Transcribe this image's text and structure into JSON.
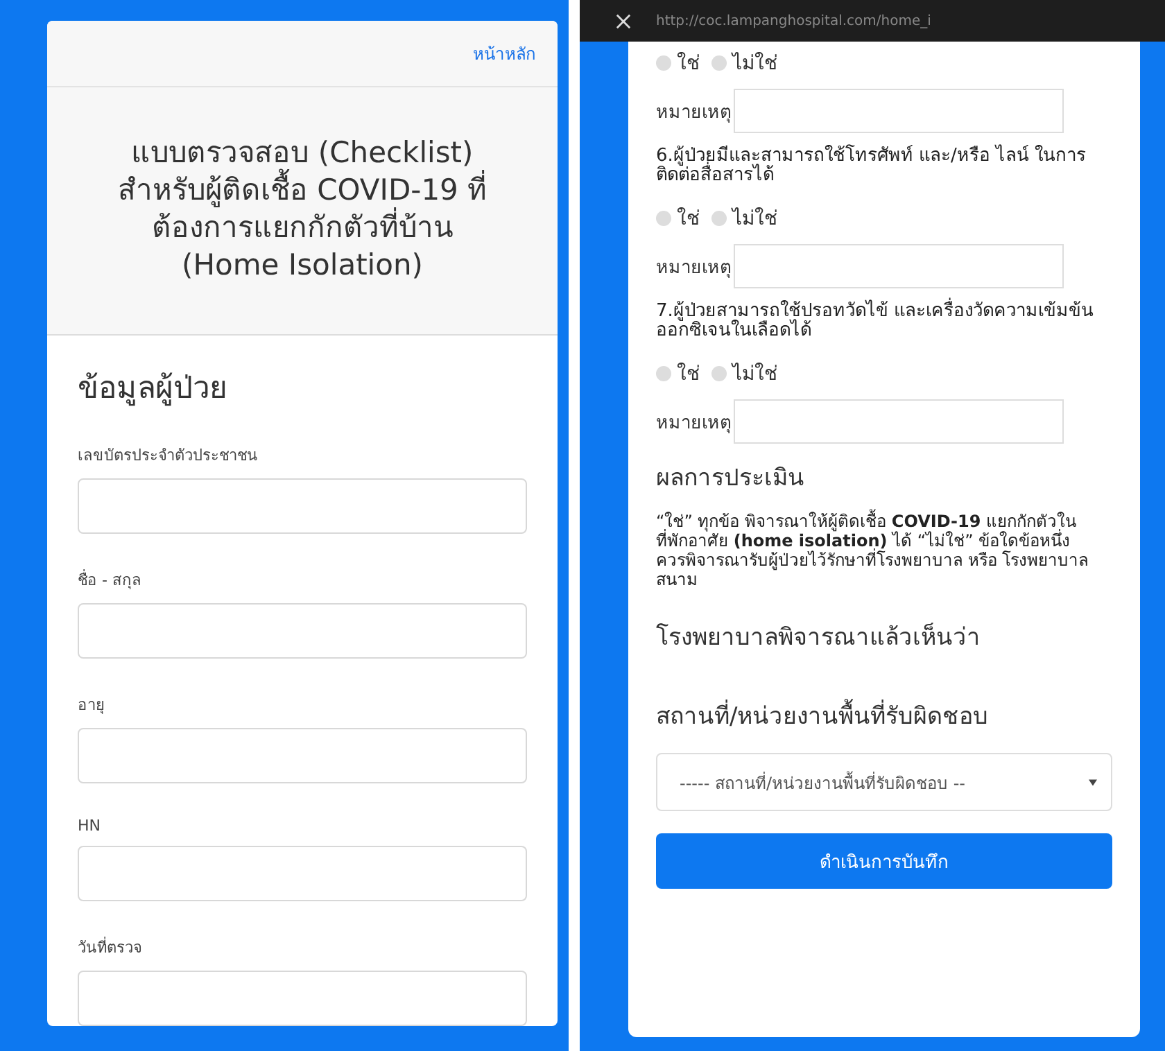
{
  "left_screen": {
    "header_link": "หน้าหลัก",
    "title": "แบบตรวจสอบ (Checklist) สำหรับผู้ติดเชื้อ COVID-19 ที่ต้องการแยกกักตัวที่บ้าน (Home Isolation)",
    "section_title": "ข้อมูลผู้ป่วย",
    "fields": [
      {
        "label": "เลขบัตรประจำตัวประชาชน"
      },
      {
        "label": "ชื่อ - สกุล"
      },
      {
        "label": "อายุ"
      },
      {
        "label": "HN"
      },
      {
        "label": "วันที่ตรวจ"
      }
    ]
  },
  "right_screen": {
    "browser_bar": {
      "url": "http://coc.lampanghospital.com/home_i"
    },
    "questions": [
      {
        "options": [
          {
            "label": "ใช่",
            "selected": false
          },
          {
            "label": "ไม่ใช่",
            "selected": false
          }
        ],
        "note_label": "หมายเหตุ"
      },
      {
        "text": "6.ผู้ป่วยมีและสามารถใช้โทรศัพท์ และ/หรือ ไลน์ ในการติดต่อสื่อสารได้",
        "options": [
          {
            "label": "ใช่",
            "selected": false
          },
          {
            "label": "ไม่ใช่",
            "selected": false
          }
        ],
        "note_label": "หมายเหตุ"
      },
      {
        "text": "7.ผู้ป่วยสามารถใช้ปรอทวัดไข้ และเครื่องวัดความเข้มข้นออกซิเจนในเลือดได้",
        "options": [
          {
            "label": "ใช่",
            "selected": false
          },
          {
            "label": "ไม่ใช่",
            "selected": false
          }
        ],
        "note_label": "หมายเหตุ"
      }
    ],
    "result_title": "ผลการประเมิน",
    "result_text": "“ใช่” ทุกข้อ พิจารณาให้ผู้ติดเชื้อ **COVID-19** แยกกักตัวในที่พักอาศัย **(home isolation)** ได้ “ไม่ใช่” ข้อใดข้อหนึ่ง ควรพิจารณารับผู้ป่วยไว้รักษาที่โรงพยาบาล หรือ โรงพยาบาลสนาม",
    "opinion_title": "โรงพยาบาลพิจารณาแล้วเห็นว่า",
    "area_title": "สถานที่/หน่วยงานพื้นที่รับผิดชอบ",
    "area_select": {
      "value": "----- สถานที่/หน่วยงานพื้นที่รับผิดชอบ --"
    },
    "submit_button": "ดำเนินการบันทึก"
  }
}
